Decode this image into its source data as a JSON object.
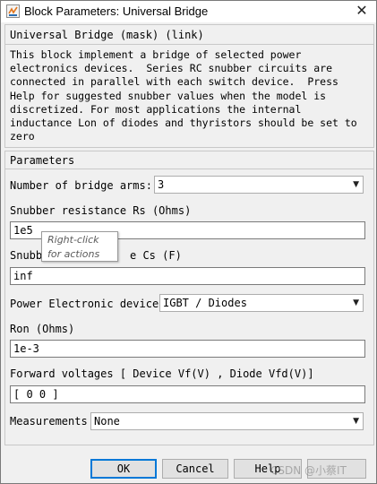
{
  "window": {
    "title": "Block Parameters: Universal Bridge",
    "close_glyph": "✕"
  },
  "mask": {
    "heading": "Universal Bridge (mask) (link)",
    "description": "This block implement a bridge of selected power\nelectronics devices.  Series RC snubber circuits are\nconnected in parallel with each switch device.  Press\nHelp for suggested snubber values when the model is\ndiscretized. For most applications the internal\ninductance Lon of diodes and thyristors should be set to\nzero"
  },
  "parameters": {
    "heading": "Parameters",
    "bridge_arms": {
      "label": "Number of bridge arms:",
      "value": "3"
    },
    "rs": {
      "label": "Snubber resistance Rs (Ohms)",
      "value": "1e5"
    },
    "cs": {
      "label_left": "Snubb",
      "label_right": "e Cs (F)",
      "value": "inf"
    },
    "device": {
      "label": "Power Electronic device",
      "value": "IGBT / Diodes"
    },
    "ron": {
      "label": "Ron (Ohms)",
      "value": "1e-3"
    },
    "forward": {
      "label": "Forward voltages  [ Device Vf(V) , Diode Vfd(V)]",
      "value": "[  0  0  ]"
    },
    "measurements": {
      "label": "Measurements",
      "value": "None"
    }
  },
  "tooltip": {
    "line1": "Right-click",
    "line2": "for actions"
  },
  "buttons": {
    "ok": "OK",
    "cancel": "Cancel",
    "help": "Help"
  },
  "watermark": "CSDN @小蔡IT",
  "colors": {
    "accent": "#0078d7",
    "panel": "#f0f0f0"
  }
}
